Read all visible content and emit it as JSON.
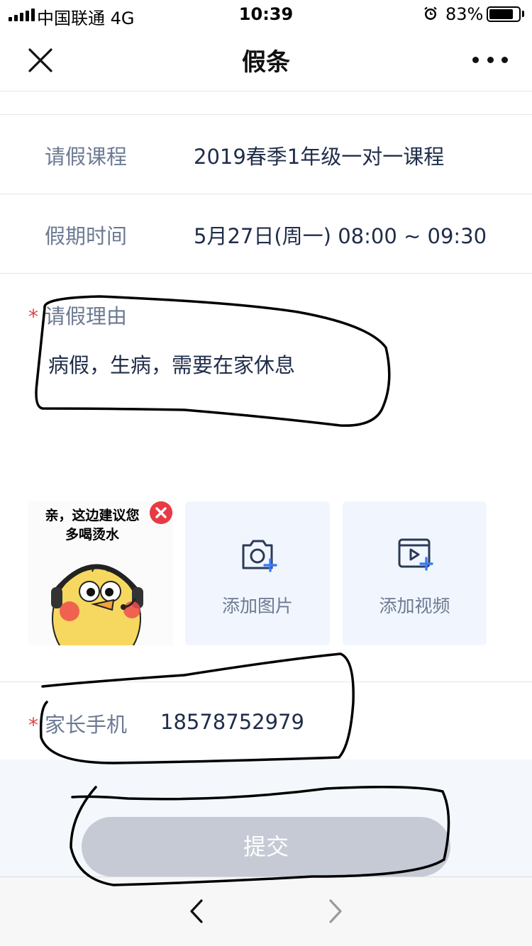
{
  "status_bar": {
    "carrier": "中国联通   4G",
    "time": "10:39",
    "battery_percent": "83%",
    "battery_level": 0.83,
    "alarm_icon": "alarm-clock-icon"
  },
  "nav": {
    "title": "假条",
    "close_icon": "close-icon",
    "more_icon": "more-dots-icon"
  },
  "form": {
    "course": {
      "label": "请假课程",
      "value": "2019春季1年级一对一课程"
    },
    "period": {
      "label": "假期时间",
      "value": "5月27日(周一) 08:00 ~ 09:30"
    },
    "reason": {
      "required_mark": "*",
      "label": "请假理由",
      "value": "病假，生病，需要在家休息"
    },
    "attachments": {
      "sticker_caption_line1": "亲，这边建议您",
      "sticker_caption_line2": "多喝烫水",
      "add_image_label": "添加图片",
      "add_video_label": "添加视频"
    },
    "phone": {
      "required_mark": "*",
      "label": "家长手机",
      "value": "18578752979"
    }
  },
  "submit_label": "提交",
  "colors": {
    "label": "#6c7a93",
    "value": "#1f2d4a",
    "required": "#e04545",
    "accent_blue": "#3b7cf5",
    "submit_disabled": "#c6cad5",
    "tile_bg": "#f1f6fe"
  }
}
